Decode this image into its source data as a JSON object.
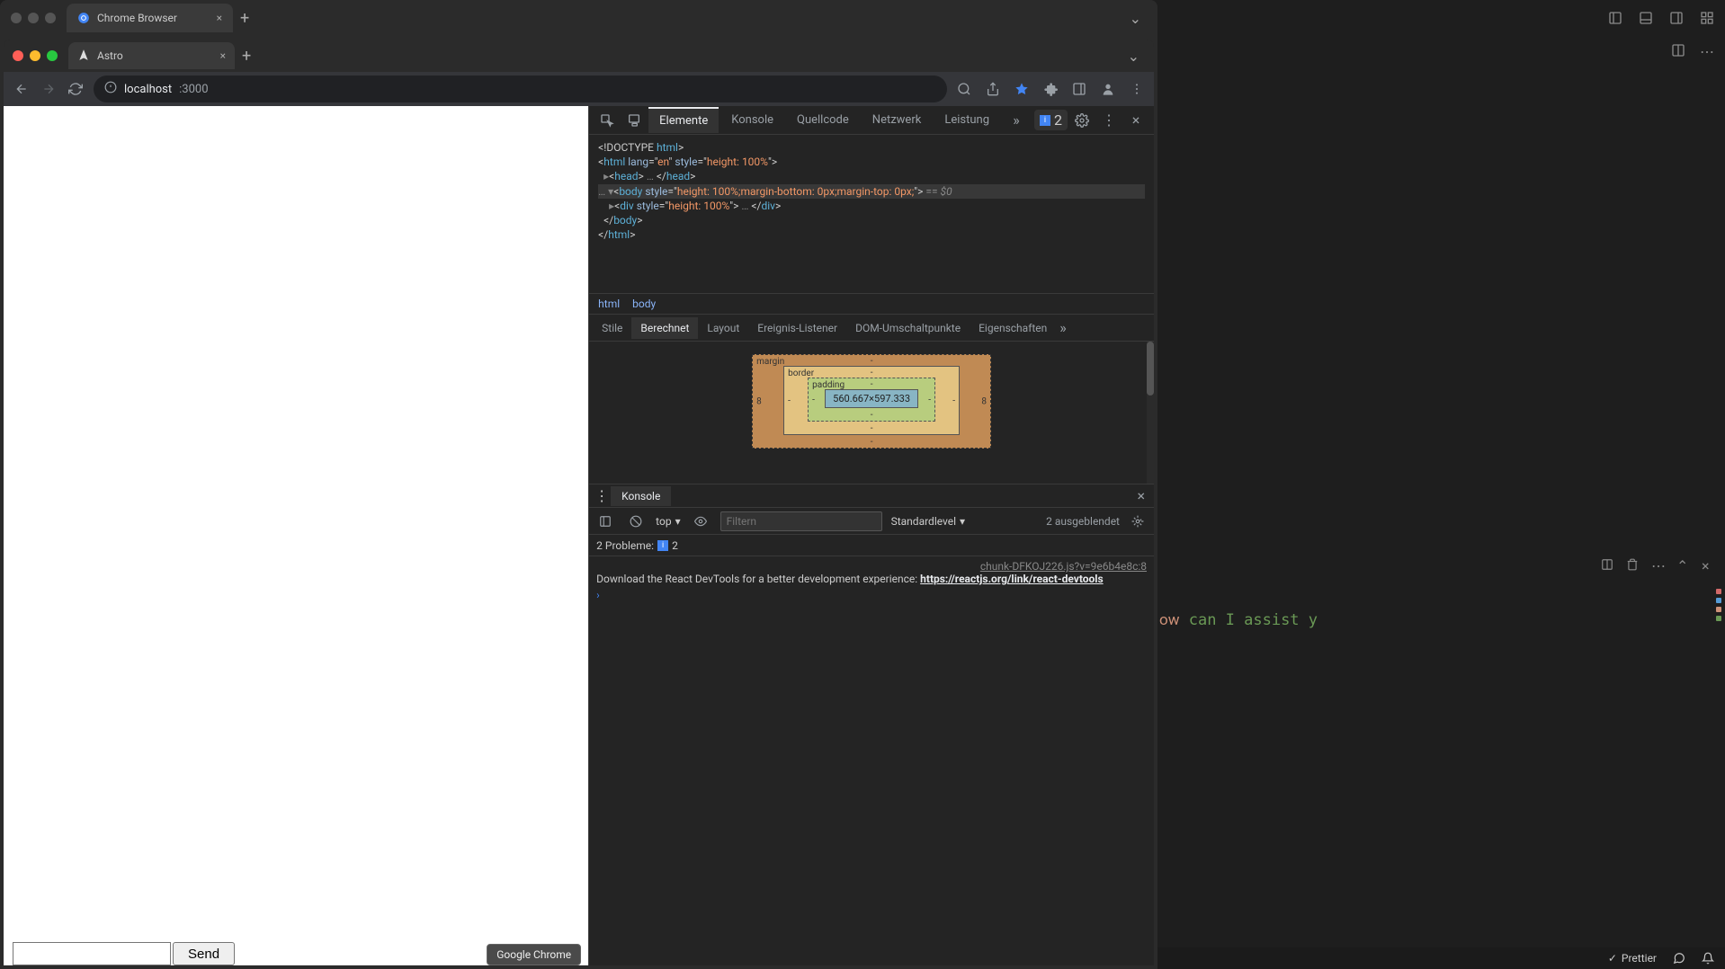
{
  "outer_window": {
    "tab_title": "Chrome Browser",
    "chevron": "⌄"
  },
  "browser": {
    "tab_title": "Astro",
    "url_host": "localhost",
    "url_port": ":3000",
    "dock_tooltip": "Google Chrome",
    "send_button": "Send",
    "issues_count": "2"
  },
  "devtools": {
    "tabs": [
      "Elemente",
      "Konsole",
      "Quellcode",
      "Netzwerk",
      "Leistung"
    ],
    "active_tab": 0,
    "issues_badge": "2",
    "elements": {
      "l1": "<!DOCTYPE html>",
      "l2_open": "<html lang=\"en\" style=\"height: 100%\">",
      "l3": "<head> … </head>",
      "l4": "<body style=\"height: 100%;margin-bottom: 0px;margin-top: 0px;\"> == $0",
      "l5": "<div style=\"height: 100%\"> … </div>",
      "l6": "</body>",
      "l7": "</html>"
    },
    "breadcrumbs": [
      "html",
      "body"
    ],
    "styles_tabs": [
      "Stile",
      "Berechnet",
      "Layout",
      "Ereignis-Listener",
      "DOM-Umschaltpunkte",
      "Eigenschaften"
    ],
    "styles_active": 1,
    "box_model": {
      "margin_label": "margin",
      "border_label": "border",
      "padding_label": "padding",
      "margin": {
        "t": "-",
        "r": "8",
        "b": "-",
        "l": "8"
      },
      "border": {
        "t": "-",
        "r": "-",
        "b": "-",
        "l": "-"
      },
      "padding": {
        "t": "-",
        "r": "-",
        "b": "-",
        "l": "-"
      },
      "content": "560.667×597.333"
    }
  },
  "drawer": {
    "tab": "Konsole",
    "context": "top",
    "filter_placeholder": "Filtern",
    "level": "Standardlevel",
    "hidden": "2 ausgeblendet",
    "problems_label": "2 Probleme:",
    "problems_count": "2",
    "source_link": "chunk-DFKOJ226.js?v=9e6b4e8c:8",
    "message_pre": "Download the React DevTools for a better development experience: ",
    "message_link": "https://reactjs.org/link/react-devtools"
  },
  "vscode": {
    "term_line": "ow can I assist y",
    "status_prettier": "Prettier",
    "minimap_colors": [
      "#d16969",
      "#569cd6",
      "#ce9178",
      "#6a9955"
    ]
  }
}
